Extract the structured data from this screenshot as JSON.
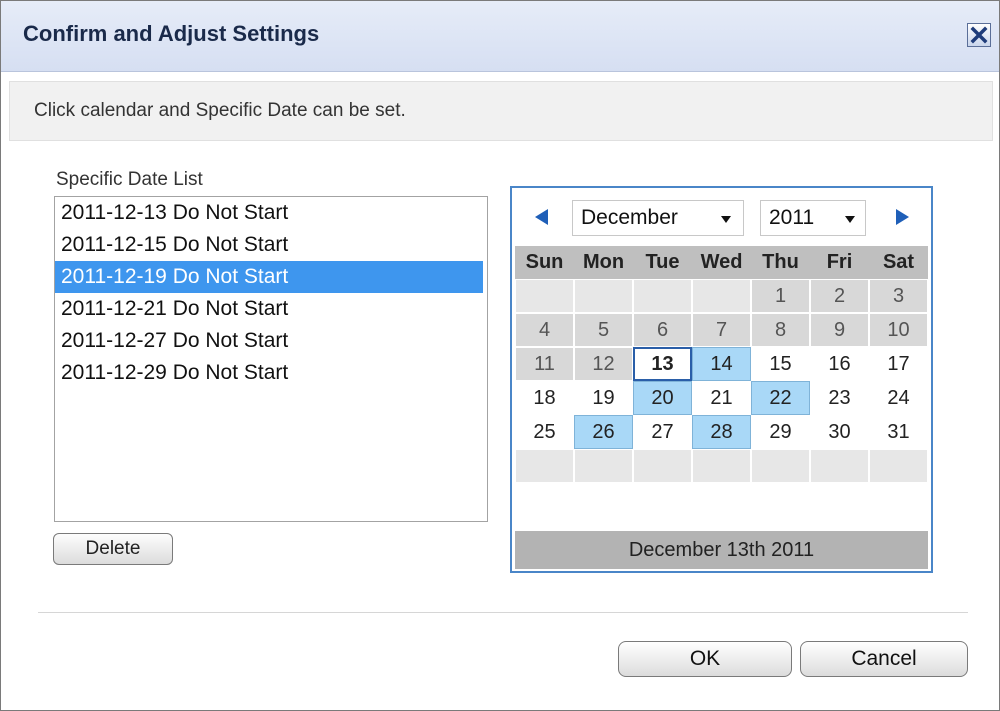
{
  "dialog": {
    "title": "Confirm and Adjust Settings",
    "close_icon": "close-icon"
  },
  "info": {
    "text": "Click calendar and Specific Date can be set."
  },
  "list": {
    "label": "Specific Date List",
    "items": [
      {
        "text": "2011-12-13 Do Not Start",
        "selected": false
      },
      {
        "text": "2011-12-15 Do Not Start",
        "selected": false
      },
      {
        "text": "2011-12-19 Do Not Start",
        "selected": true
      },
      {
        "text": "2011-12-21 Do Not Start",
        "selected": false
      },
      {
        "text": "2011-12-27 Do Not Start",
        "selected": false
      },
      {
        "text": "2011-12-29 Do Not Start",
        "selected": false
      }
    ],
    "delete_label": "Delete"
  },
  "calendar": {
    "month": "December",
    "year": "2011",
    "prev_icon": "triangle-left-icon",
    "next_icon": "triangle-right-icon",
    "days_of_week": [
      "Sun",
      "Mon",
      "Tue",
      "Wed",
      "Thu",
      "Fri",
      "Sat"
    ],
    "weeks": [
      [
        "",
        "",
        "",
        "",
        "1",
        "2",
        "3"
      ],
      [
        "4",
        "5",
        "6",
        "7",
        "8",
        "9",
        "10"
      ],
      [
        "11",
        "12",
        "13",
        "14",
        "15",
        "16",
        "17"
      ],
      [
        "18",
        "19",
        "20",
        "21",
        "22",
        "23",
        "24"
      ],
      [
        "25",
        "26",
        "27",
        "28",
        "29",
        "30",
        "31"
      ],
      [
        "",
        "",
        "",
        "",
        "",
        "",
        ""
      ]
    ],
    "today": "13",
    "marked_days": [
      "14",
      "20",
      "22",
      "26",
      "28"
    ],
    "past_days": [
      "1",
      "2",
      "3",
      "4",
      "5",
      "6",
      "7",
      "8",
      "9",
      "10",
      "11",
      "12"
    ],
    "footer": "December 13th 2011"
  },
  "buttons": {
    "ok": "OK",
    "cancel": "Cancel"
  },
  "colors": {
    "accent": "#3e96ee",
    "marked": "#a9d8f7",
    "calendar_border": "#4a86c8"
  }
}
